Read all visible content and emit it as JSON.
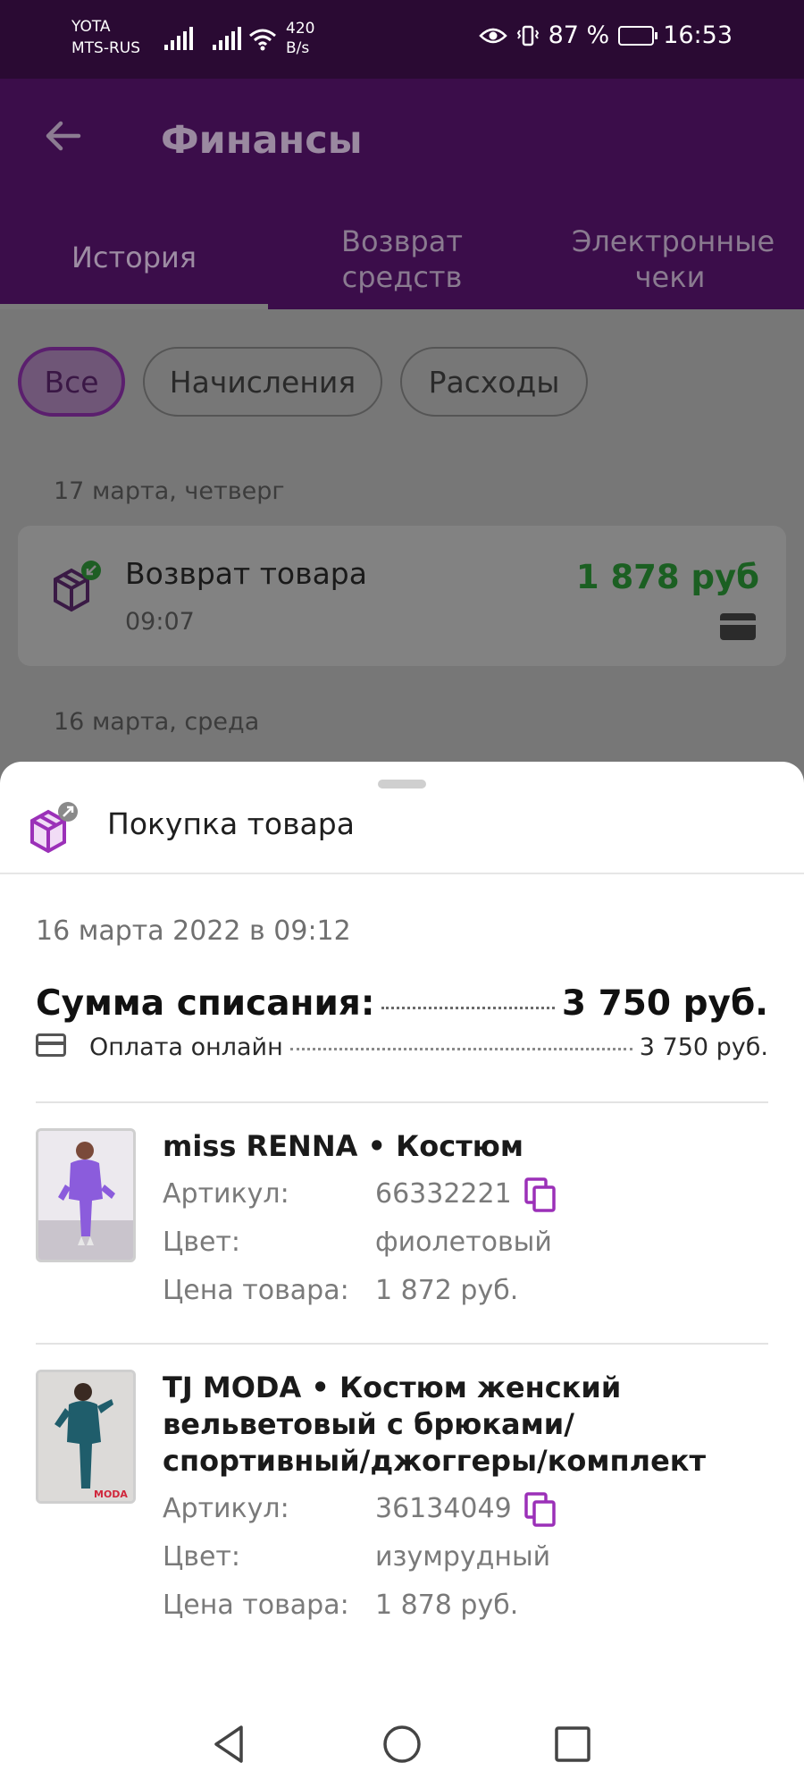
{
  "status_bar": {
    "carrier1": "YOTA",
    "carrier2": "MTS-RUS",
    "speed_value": "420",
    "speed_unit": "B/s",
    "battery": "87 %",
    "time": "16:53"
  },
  "app_bar": {
    "title": "Финансы",
    "tabs": [
      {
        "label": "История"
      },
      {
        "label": "Возврат средств"
      },
      {
        "label": "Электронные чеки"
      }
    ]
  },
  "filters": {
    "chips": [
      {
        "label": "Все"
      },
      {
        "label": "Начисления"
      },
      {
        "label": "Расходы"
      }
    ]
  },
  "history": {
    "day1": "17 марта, четверг",
    "tx": {
      "title": "Возврат товара",
      "time": "09:07",
      "amount": "1 878 руб",
      "amount_color": "#1b5f22"
    },
    "day2": "16 марта, среда"
  },
  "sheet": {
    "title": "Покупка товара",
    "date": "16 марта 2022 в 09:12",
    "sum_label": "Сумма списания:",
    "sum_value": "3 750 руб.",
    "payment_label": "Оплата онлайн",
    "payment_value": "3 750 руб.",
    "accent": "#9b30b8",
    "items": [
      {
        "name": "miss RENNA • Костюм",
        "article_label": "Артикул:",
        "article": "66332221",
        "color_label": "Цвет:",
        "color": "фиолетовый",
        "price_label": "Цена товара:",
        "price": "1 872 руб."
      },
      {
        "name": "TJ MODA • Костюм женский вельветовый с брюками/спортивный/джоггеры/комплект",
        "article_label": "Артикул:",
        "article": "36134049",
        "color_label": "Цвет:",
        "color": "изумрудный",
        "price_label": "Цена товара:",
        "price": "1 878 руб.",
        "thumb_caption": "MODA"
      }
    ]
  },
  "nav": {
    "icons": [
      "back-triangle-icon",
      "home-circle-icon",
      "recents-square-icon"
    ]
  }
}
